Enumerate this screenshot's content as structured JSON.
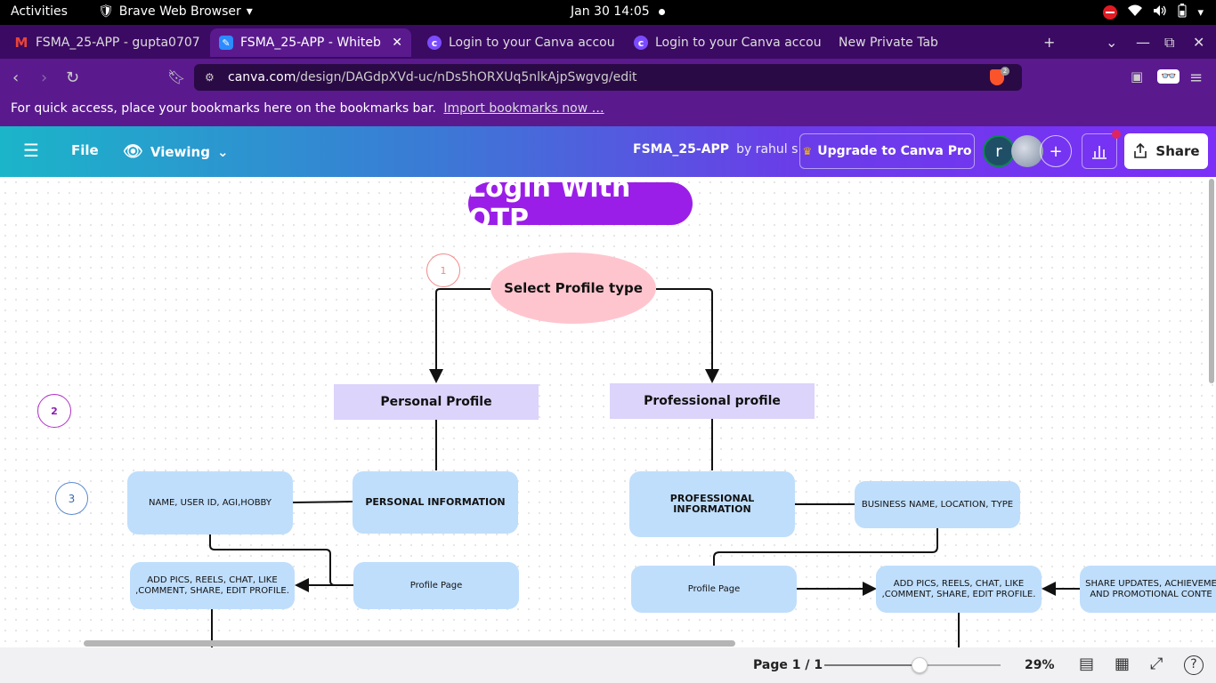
{
  "system": {
    "activities": "Activities",
    "app_name": "Brave Web Browser",
    "clock": "Jan 30  14:05"
  },
  "tabs": [
    {
      "label": "FSMA_25-APP - gupta0707",
      "icon": "gmail-icon"
    },
    {
      "label": "FSMA_25-APP - Whiteb",
      "icon": "canva-app-icon"
    },
    {
      "label": "Login to your Canva accou",
      "icon": "canva-icon"
    },
    {
      "label": "Login to your Canva accou",
      "icon": "canva-icon"
    },
    {
      "label": "New Private Tab",
      "icon": ""
    }
  ],
  "address": {
    "host": "canva.com",
    "path": "/design/DAGdpXVd-uc/nDs5hORXUq5nlkAjpSwgvg/edit",
    "shields_count": "2"
  },
  "bookmarks": {
    "message": "For quick access, place your bookmarks here on the bookmarks bar.",
    "import_link": "Import bookmarks now …"
  },
  "canva": {
    "file_label": "File",
    "viewing_label": "Viewing",
    "design_title": "FSMA_25-APP",
    "by_label": "by rahul s",
    "upgrade_label": "Upgrade to Canva Pro",
    "avatar_initial": "r",
    "share_label": "Share"
  },
  "diagram": {
    "title": "Login With OTP",
    "step1": "1",
    "step2": "2",
    "step3": "3",
    "select_profile": "Select Profile type",
    "personal_profile": "Personal Profile",
    "professional_profile": "Professional profile",
    "personal_info": "PERSONAL INFORMATION",
    "name_fields": "NAME, USER ID, AGI,HOBBY",
    "personal_profile_page": "Profile Page",
    "personal_actions": "ADD PICS, REELS, CHAT, LIKE ,COMMENT, SHARE, EDIT PROFILE.",
    "professional_info": "PROFESSIONAL INFORMATION",
    "business_fields": "BUSINESS NAME, LOCATION, TYPE",
    "professional_profile_page": "Profile Page",
    "professional_actions": "ADD PICS, REELS, CHAT, LIKE ,COMMENT, SHARE, EDIT PROFILE.",
    "share_updates": "SHARE UPDATES, ACHIEVEME AND PROMOTIONAL CONTE"
  },
  "footer": {
    "page_info": "Page 1 / 1",
    "zoom": "29%",
    "zoom_fraction": 0.54
  }
}
